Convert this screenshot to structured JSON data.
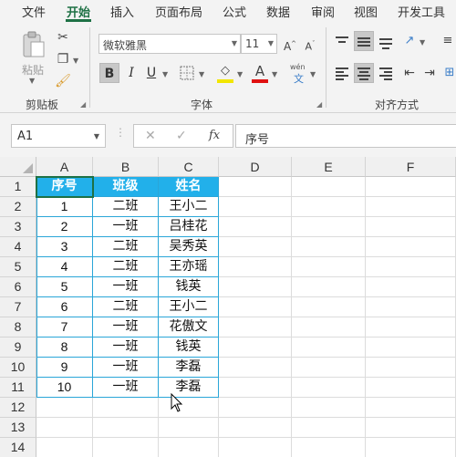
{
  "menu": {
    "items": [
      "文件",
      "开始",
      "插入",
      "页面布局",
      "公式",
      "数据",
      "审阅",
      "视图",
      "开发工具"
    ],
    "active": "开始"
  },
  "ribbon": {
    "clipboard": {
      "paste_label": "粘贴",
      "group_label": "剪贴板"
    },
    "font": {
      "font_name": "微软雅黑",
      "font_size": "11",
      "bold": "B",
      "italic": "I",
      "underline": "U",
      "font_color_glyph": "A",
      "phonetic_top": "wén",
      "phonetic_bottom": "文",
      "group_label": "字体"
    },
    "alignment": {
      "group_label": "对齐方式"
    }
  },
  "formula_bar": {
    "name_box": "A1",
    "fx": "fx",
    "content": "序号"
  },
  "grid": {
    "columns": [
      "A",
      "B",
      "C",
      "D",
      "E",
      "F"
    ],
    "rows": [
      "1",
      "2",
      "3",
      "4",
      "5",
      "6",
      "7",
      "8",
      "9",
      "10",
      "11",
      "12",
      "13",
      "14"
    ],
    "table_header": [
      "序号",
      "班级",
      "姓名"
    ],
    "table_rows": [
      [
        "1",
        "二班",
        "王小二"
      ],
      [
        "2",
        "一班",
        "吕桂花"
      ],
      [
        "3",
        "二班",
        "吴秀英"
      ],
      [
        "4",
        "二班",
        "王亦瑶"
      ],
      [
        "5",
        "一班",
        "钱英"
      ],
      [
        "6",
        "二班",
        "王小二"
      ],
      [
        "7",
        "一班",
        "花傲文"
      ],
      [
        "8",
        "一班",
        "钱英"
      ],
      [
        "9",
        "一班",
        "李磊"
      ],
      [
        "10",
        "一班",
        "李磊"
      ]
    ]
  },
  "colors": {
    "accent": "#1e7145",
    "table_header": "#22b0ea",
    "table_border": "#2aa6d8"
  }
}
